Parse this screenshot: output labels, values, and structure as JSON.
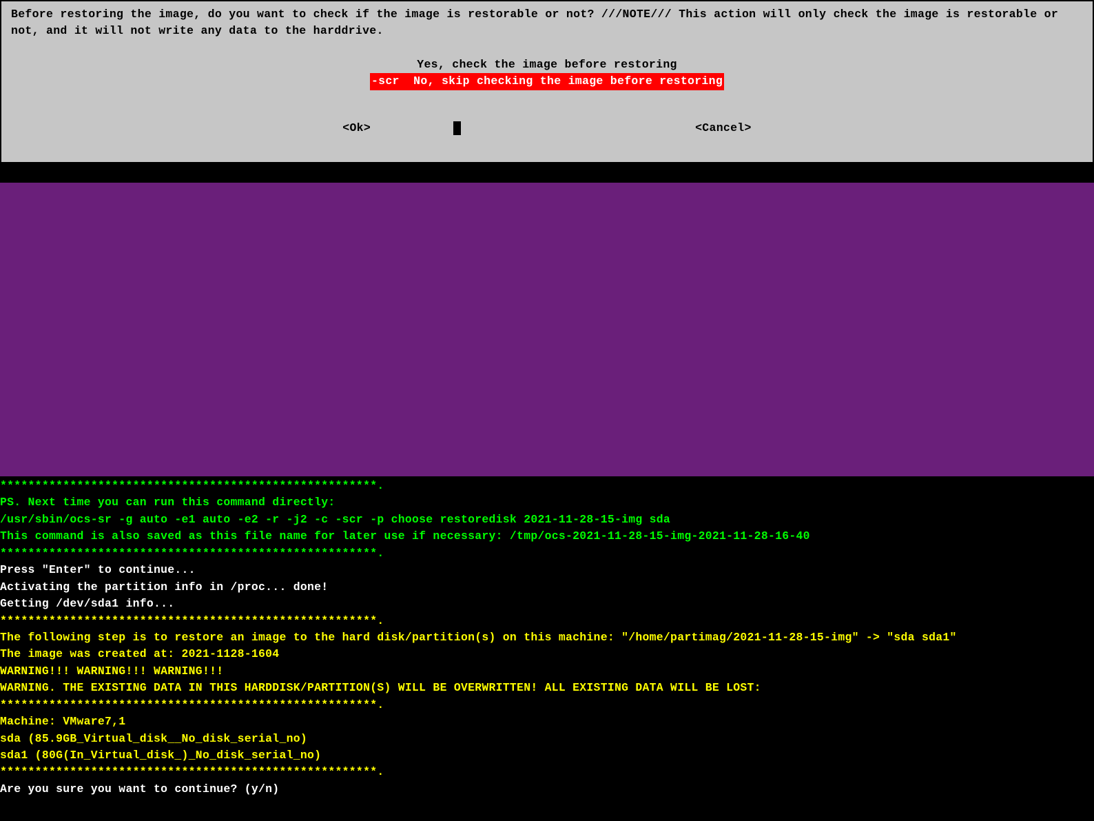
{
  "dialog": {
    "prompt": "Before restoring the image, do you want to check if the image is restorable or not? ///NOTE/// This action will only check the image is restorable or not, and it will not write any data to the harddrive.",
    "option_yes": "Yes, check the image before restoring",
    "option_no": "-scr  No, skip checking the image before restoring",
    "ok_label": "<Ok>",
    "cancel_label": "<Cancel>"
  },
  "terminal": {
    "lines": [
      {
        "cls": "c-green",
        "text": "******************************************************."
      },
      {
        "cls": "c-green",
        "text": "PS. Next time you can run this command directly:"
      },
      {
        "cls": "c-green",
        "text": "/usr/sbin/ocs-sr -g auto -e1 auto -e2 -r -j2 -c -scr -p choose restoredisk 2021-11-28-15-img sda"
      },
      {
        "cls": "c-green",
        "text": "This command is also saved as this file name for later use if necessary: /tmp/ocs-2021-11-28-15-img-2021-11-28-16-40"
      },
      {
        "cls": "c-green",
        "text": "******************************************************."
      },
      {
        "cls": "c-white",
        "text": "Press \"Enter\" to continue..."
      },
      {
        "cls": "c-white",
        "text": "Activating the partition info in /proc... done!"
      },
      {
        "cls": "c-white",
        "text": "Getting /dev/sda1 info..."
      },
      {
        "cls": "c-yellow",
        "text": "******************************************************."
      },
      {
        "cls": "c-yellow",
        "text": "The following step is to restore an image to the hard disk/partition(s) on this machine: \"/home/partimag/2021-11-28-15-img\" -> \"sda sda1\""
      },
      {
        "cls": "c-yellow",
        "text": "The image was created at: 2021-1128-1604"
      },
      {
        "cls": "c-yellow",
        "text": "WARNING!!! WARNING!!! WARNING!!!"
      },
      {
        "cls": "c-yellow",
        "text": "WARNING. THE EXISTING DATA IN THIS HARDDISK/PARTITION(S) WILL BE OVERWRITTEN! ALL EXISTING DATA WILL BE LOST:"
      },
      {
        "cls": "c-yellow",
        "text": "******************************************************."
      },
      {
        "cls": "c-yellow",
        "text": "Machine: VMware7,1"
      },
      {
        "cls": "c-yellow",
        "text": "sda (85.9GB_Virtual_disk__No_disk_serial_no)"
      },
      {
        "cls": "c-yellow",
        "text": "sda1 (80G(In_Virtual_disk_)_No_disk_serial_no)"
      },
      {
        "cls": "c-yellow",
        "text": "******************************************************."
      },
      {
        "cls": "c-white",
        "text": "Are you sure you want to continue? (y/n)"
      }
    ]
  }
}
